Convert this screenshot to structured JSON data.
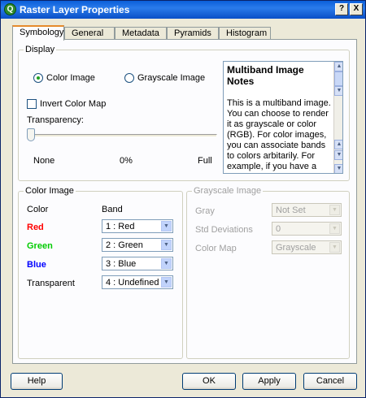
{
  "window": {
    "title": "Raster Layer Properties",
    "help_glyph": "?",
    "close_glyph": "X",
    "app_icon_glyph": "Q"
  },
  "tabs": [
    {
      "label": "Symbology",
      "active": true
    },
    {
      "label": "General",
      "active": false
    },
    {
      "label": "Metadata",
      "active": false
    },
    {
      "label": "Pyramids",
      "active": false
    },
    {
      "label": "Histogram",
      "active": false
    }
  ],
  "display": {
    "legend": "Display",
    "color_radio_label": "Color Image",
    "grayscale_radio_label": "Grayscale Image",
    "selected_mode": "Color Image",
    "invert_label": "Invert Color Map",
    "invert_checked": false,
    "transparency_label": "Transparency:",
    "transparency_value": 0,
    "tick_none": "None",
    "tick_zero": "0%",
    "tick_full": "Full"
  },
  "notes": {
    "title": "Multiband Image Notes",
    "body": "This is a multiband image. You can choose to render it as grayscale or color (RGB). For color images, you can associate bands to colors arbitarily. For example, if you have a seven band landsat image, you may"
  },
  "color_image": {
    "legend": "Color Image",
    "col_color": "Color",
    "col_band": "Band",
    "rows": [
      {
        "label": "Red",
        "value": "1 : Red",
        "color": "#ff0000"
      },
      {
        "label": "Green",
        "value": "2 : Green",
        "color": "#00cc00"
      },
      {
        "label": "Blue",
        "value": "3 : Blue",
        "color": "#0000ff"
      },
      {
        "label": "Transparent",
        "value": "4 : Undefined",
        "color": "#000000"
      }
    ]
  },
  "grayscale_image": {
    "legend": "Grayscale Image",
    "rows": [
      {
        "label": "Gray",
        "value": "Not Set"
      },
      {
        "label": "Std Deviations",
        "value": "0"
      },
      {
        "label": "Color Map",
        "value": "Grayscale"
      }
    ]
  },
  "buttons": {
    "help": "Help",
    "ok": "OK",
    "apply": "Apply",
    "cancel": "Cancel"
  },
  "icons": {
    "arrow_down": "▼",
    "arrow_up": "▲"
  }
}
